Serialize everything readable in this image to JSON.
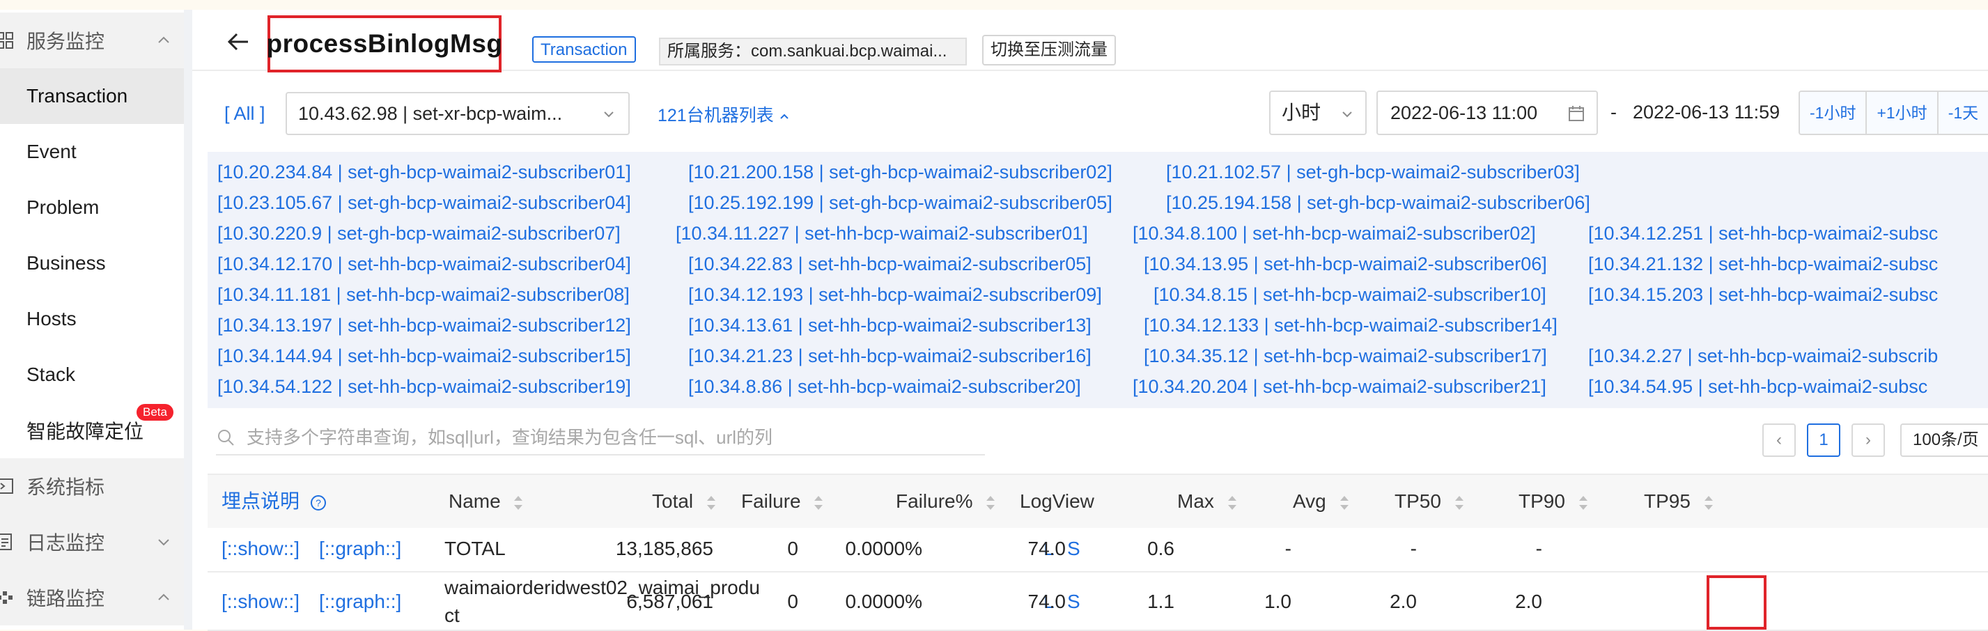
{
  "sidebar": {
    "items": [
      {
        "label": "服务监控",
        "type": "group",
        "icon": "grid-icon",
        "chevron": "up"
      },
      {
        "label": "Transaction",
        "type": "sub",
        "active": true
      },
      {
        "label": "Event",
        "type": "sub"
      },
      {
        "label": "Problem",
        "type": "sub"
      },
      {
        "label": "Business",
        "type": "sub"
      },
      {
        "label": "Hosts",
        "type": "sub"
      },
      {
        "label": "Stack",
        "type": "sub"
      },
      {
        "label": "智能故障定位",
        "type": "sub",
        "badge": "Beta"
      },
      {
        "label": "系统指标",
        "type": "group",
        "icon": "terminal-icon"
      },
      {
        "label": "日志监控",
        "type": "group",
        "icon": "log-icon",
        "chevron": "down"
      },
      {
        "label": "链路监控",
        "type": "group",
        "icon": "link-icon",
        "chevron": "up"
      }
    ]
  },
  "header": {
    "title": "processBinlogMsg",
    "tag": "Transaction",
    "service": "所属服务：com.sankuai.bcp.waimai...",
    "switch_button": "切换至压测流量"
  },
  "filters": {
    "all": "[ All ]",
    "host": "10.43.62.98 | set-xr-bcp-waim...",
    "machine_list": "121台机器列表",
    "unit": "小时",
    "start": "2022-06-13 11:00",
    "dash": "-",
    "end": "2022-06-13 11:59",
    "shift_buttons": [
      "-1小时",
      "+1小时",
      "-1天"
    ]
  },
  "hosts": [
    [
      "[10.20.234.84 | set-gh-bcp-waimai2-subscriber01]",
      "[10.21.200.158 | set-gh-bcp-waimai2-subscriber02]",
      "[10.21.102.57 | set-gh-bcp-waimai2-subscriber03]"
    ],
    [
      "[10.23.105.67 | set-gh-bcp-waimai2-subscriber04]",
      "[10.25.192.199 | set-gh-bcp-waimai2-subscriber05]",
      "[10.25.194.158 | set-gh-bcp-waimai2-subscriber06]"
    ],
    [
      "[10.30.220.9 | set-gh-bcp-waimai2-subscriber07]",
      "[10.34.11.227 | set-hh-bcp-waimai2-subscriber01]",
      "[10.34.8.100 | set-hh-bcp-waimai2-subscriber02]",
      "[10.34.12.251 | set-hh-bcp-waimai2-subsc"
    ],
    [
      "[10.34.12.170 | set-hh-bcp-waimai2-subscriber04]",
      "[10.34.22.83 | set-hh-bcp-waimai2-subscriber05]",
      "[10.34.13.95 | set-hh-bcp-waimai2-subscriber06]",
      "[10.34.21.132 | set-hh-bcp-waimai2-subsc"
    ],
    [
      "[10.34.11.181 | set-hh-bcp-waimai2-subscriber08]",
      "[10.34.12.193 | set-hh-bcp-waimai2-subscriber09]",
      "[10.34.8.15 | set-hh-bcp-waimai2-subscriber10]",
      "[10.34.15.203 | set-hh-bcp-waimai2-subsc"
    ],
    [
      "[10.34.13.197 | set-hh-bcp-waimai2-subscriber12]",
      "[10.34.13.61 | set-hh-bcp-waimai2-subscriber13]",
      "[10.34.12.133 | set-hh-bcp-waimai2-subscriber14]"
    ],
    [
      "[10.34.144.94 | set-hh-bcp-waimai2-subscriber15]",
      "[10.34.21.23 | set-hh-bcp-waimai2-subscriber16]",
      "[10.34.35.12 | set-hh-bcp-waimai2-subscriber17]",
      "[10.34.2.27 | set-hh-bcp-waimai2-subscrib"
    ],
    [
      "[10.34.54.122 | set-hh-bcp-waimai2-subscriber19]",
      "[10.34.8.86 | set-hh-bcp-waimai2-subscriber20]",
      "[10.34.20.204 | set-hh-bcp-waimai2-subscriber21]",
      "[10.34.54.95 | set-hh-bcp-waimai2-subsc"
    ]
  ],
  "search": {
    "placeholder": "支持多个字符串查询，如sql|url，查询结果为包含任一sql、url的列"
  },
  "pager": {
    "prev": "‹",
    "current": "1",
    "next": "›",
    "page_size": "100条/页"
  },
  "table": {
    "headers": {
      "desc": "埋点说明",
      "name": "Name",
      "total": "Total",
      "failure": "Failure",
      "failure_pct": "Failure%",
      "logview": "LogView",
      "max": "Max",
      "avg": "Avg",
      "tp50": "TP50",
      "tp90": "TP90",
      "tp95": "TP95"
    },
    "rows": [
      {
        "show": "[::show::]",
        "graph": "[::graph::]",
        "name": "TOTAL",
        "total": "13,185,865",
        "failure": "0",
        "failure_pct": "0.0000%",
        "l": "L",
        "s": "S",
        "max": "74.0",
        "avg": "0.6",
        "tp50": "-",
        "tp90": "-",
        "tp95": "-"
      },
      {
        "show": "[::show::]",
        "graph": "[::graph::]",
        "name_line1": "waimaiorderidwest02_waimai_produ",
        "name_line2": "ct",
        "total": "6,587,061",
        "failure": "0",
        "failure_pct": "0.0000%",
        "l": "L",
        "s": "S",
        "max": "74.0",
        "avg": "1.1",
        "tp50": "1.0",
        "tp90": "2.0",
        "tp95": "2.0"
      }
    ]
  },
  "colors": {
    "link": "#1f6fe0",
    "highlight": "#e0242a",
    "beta": "#f5222d"
  }
}
